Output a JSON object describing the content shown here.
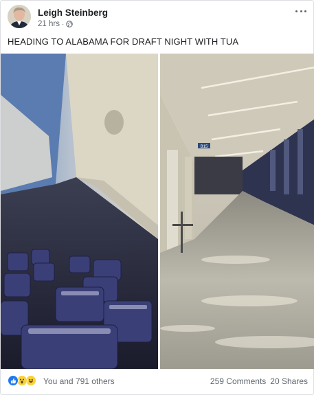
{
  "post": {
    "author": "Leigh Steinberg",
    "timestamp": "21 hrs",
    "separator": "·",
    "privacy_icon": "globe-icon",
    "text": "HEADING TO ALABAMA FOR DRAFT NIGHT WITH TUA"
  },
  "photos": [
    {
      "description": "Empty airplane cabin with rows of blue seats"
    },
    {
      "description": "Empty airport terminal corridor with reflective floor",
      "gate_sign": "B15"
    }
  ],
  "footer": {
    "reactions": [
      "like-icon",
      "wow-icon",
      "haha-icon"
    ],
    "reactors_text": "You and 791 others",
    "comments_text": "259 Comments",
    "shares_text": "20 Shares"
  },
  "colors": {
    "like_blue": "#2078f4",
    "reaction_yellow": "#f7d23a",
    "meta_gray": "#616770",
    "text_dark": "#1c1e21"
  }
}
